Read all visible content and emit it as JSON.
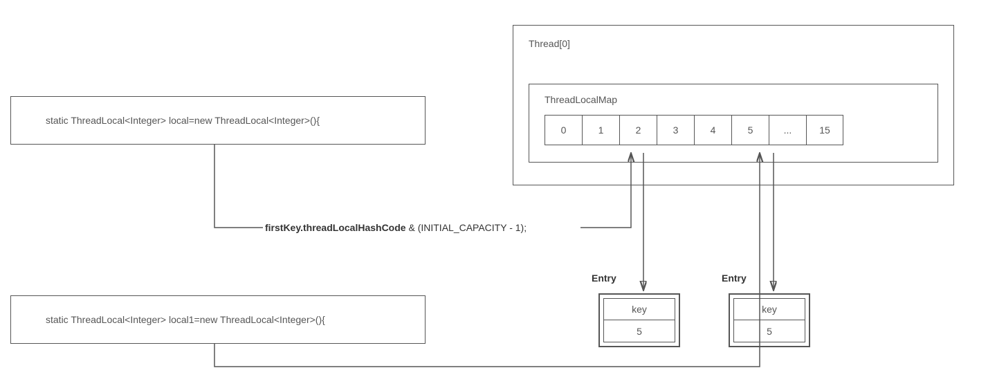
{
  "codeBox1": "static ThreadLocal<Integer> local=new ThreadLocal<Integer>(){",
  "codeBox2": "static ThreadLocal<Integer> local1=new ThreadLocal<Integer>(){",
  "threadTitle": "Thread[0]",
  "mapTitle": "ThreadLocalMap",
  "slots": [
    "0",
    "1",
    "2",
    "3",
    "4",
    "5",
    "...",
    "15"
  ],
  "formulaBold": "firstKey.threadLocalHashCode",
  "formulaRest": " & (INITIAL_CAPACITY - 1);",
  "entryLabel": "Entry",
  "entry1": {
    "key": "key",
    "value": "5"
  },
  "entry2": {
    "key": "key",
    "value": "5"
  }
}
